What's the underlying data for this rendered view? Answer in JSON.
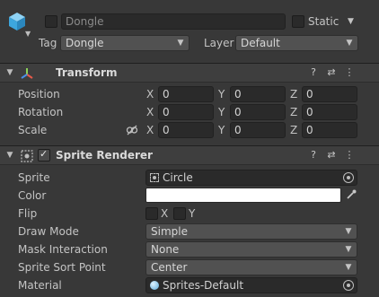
{
  "header": {
    "object_name": "Dongle",
    "static_label": "Static",
    "tag_label": "Tag",
    "tag_value": "Dongle",
    "layer_label": "Layer",
    "layer_value": "Default",
    "object_icon": "cube-icon"
  },
  "transform": {
    "title": "Transform",
    "icon": "transform-axes-icon",
    "rows": [
      {
        "label": "Position",
        "x": "0",
        "y": "0",
        "z": "0"
      },
      {
        "label": "Rotation",
        "x": "0",
        "y": "0",
        "z": "0"
      },
      {
        "label": "Scale",
        "x": "0",
        "y": "0",
        "z": "0"
      }
    ],
    "axis_x": "X",
    "axis_y": "Y",
    "axis_z": "Z"
  },
  "sprite_renderer": {
    "title": "Sprite Renderer",
    "icon": "sprite-renderer-icon",
    "sprite_label": "Sprite",
    "sprite_value": "Circle",
    "color_label": "Color",
    "color_value": "#ffffff",
    "flip_label": "Flip",
    "flip_x": "X",
    "flip_y": "Y",
    "draw_mode_label": "Draw Mode",
    "draw_mode_value": "Simple",
    "mask_label": "Mask Interaction",
    "mask_value": "None",
    "sort_point_label": "Sprite Sort Point",
    "sort_point_value": "Center",
    "material_label": "Material",
    "material_value": "Sprites-Default"
  },
  "icons": {
    "help": "?",
    "presets": "⇄",
    "more": "⋮"
  }
}
